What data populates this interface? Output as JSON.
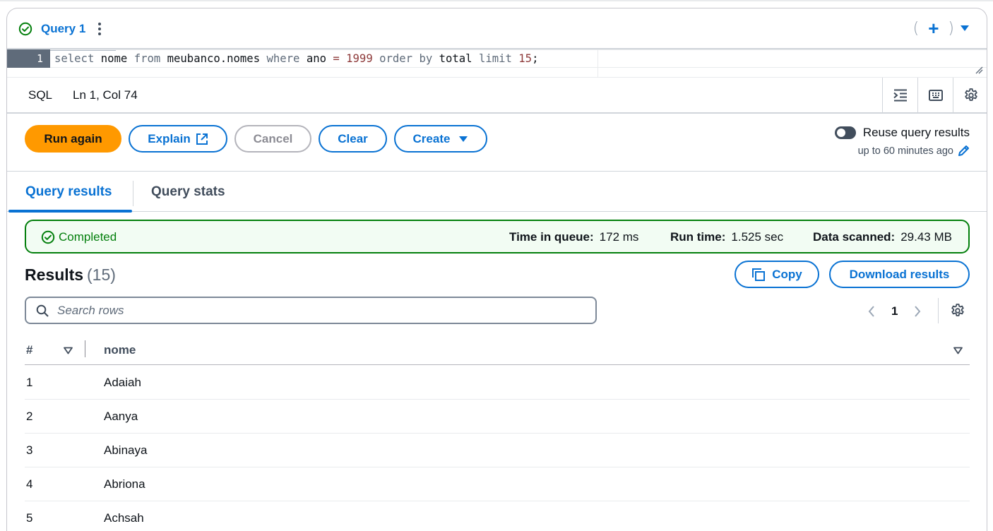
{
  "query_tab": {
    "label": "Query 1"
  },
  "editor": {
    "line_number": "1",
    "code_tokens": [
      {
        "t": "select",
        "c": "kw"
      },
      {
        "t": " ",
        "c": "id"
      },
      {
        "t": "nome",
        "c": "id"
      },
      {
        "t": " ",
        "c": "id"
      },
      {
        "t": "from",
        "c": "kw"
      },
      {
        "t": " ",
        "c": "id"
      },
      {
        "t": "meubanco.nomes",
        "c": "id"
      },
      {
        "t": " ",
        "c": "id"
      },
      {
        "t": "where",
        "c": "kw"
      },
      {
        "t": " ",
        "c": "id"
      },
      {
        "t": "ano",
        "c": "id"
      },
      {
        "t": " = ",
        "c": "k2"
      },
      {
        "t": "1999",
        "c": "num"
      },
      {
        "t": " ",
        "c": "id"
      },
      {
        "t": "order by",
        "c": "kw"
      },
      {
        "t": " ",
        "c": "id"
      },
      {
        "t": "total",
        "c": "id"
      },
      {
        "t": " ",
        "c": "id"
      },
      {
        "t": "limit",
        "c": "kw"
      },
      {
        "t": " ",
        "c": "id"
      },
      {
        "t": "15",
        "c": "num"
      },
      {
        "t": ";",
        "c": "id"
      }
    ]
  },
  "statusbar": {
    "language": "SQL",
    "cursor": "Ln 1, Col 74"
  },
  "actions": {
    "run_again": "Run again",
    "explain": "Explain",
    "cancel": "Cancel",
    "clear": "Clear",
    "create": "Create",
    "reuse_label": "Reuse query results",
    "reuse_sub": "up to 60 minutes ago"
  },
  "result_tabs": {
    "results": "Query results",
    "stats": "Query stats"
  },
  "banner": {
    "status": "Completed",
    "queue_label": "Time in queue:",
    "queue_value": "172 ms",
    "run_label": "Run time:",
    "run_value": "1.525 sec",
    "scanned_label": "Data scanned:",
    "scanned_value": "29.43 MB"
  },
  "results": {
    "title": "Results",
    "count": "(15)",
    "copy": "Copy",
    "download": "Download results",
    "search_placeholder": "Search rows",
    "page": "1",
    "columns": [
      "#",
      "nome"
    ],
    "rows": [
      {
        "n": "1",
        "nome": "Adaiah"
      },
      {
        "n": "2",
        "nome": "Aanya"
      },
      {
        "n": "3",
        "nome": "Abinaya"
      },
      {
        "n": "4",
        "nome": "Abriona"
      },
      {
        "n": "5",
        "nome": "Achsah"
      }
    ]
  },
  "colors": {
    "accent": "#0972d3",
    "primary": "#ff9900",
    "success": "#037f0c"
  }
}
